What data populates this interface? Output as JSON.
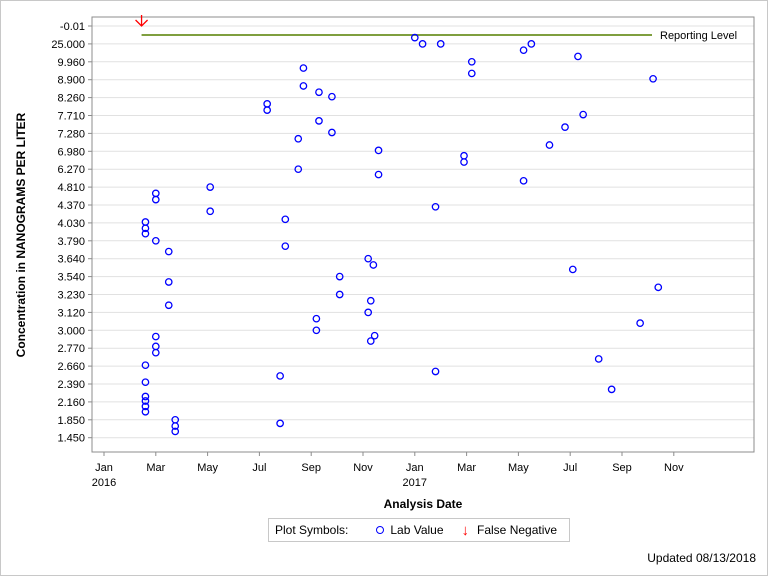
{
  "chart_data": {
    "type": "scatter",
    "xlabel": "Analysis Date",
    "ylabel": "Concentration in NANOGRAMS PER LITER",
    "x_ticks": [
      {
        "label": "Jan",
        "sub": "2016",
        "month": 0
      },
      {
        "label": "Mar",
        "sub": "",
        "month": 2
      },
      {
        "label": "May",
        "sub": "",
        "month": 4
      },
      {
        "label": "Jul",
        "sub": "",
        "month": 6
      },
      {
        "label": "Sep",
        "sub": "",
        "month": 8
      },
      {
        "label": "Nov",
        "sub": "",
        "month": 10
      },
      {
        "label": "Jan",
        "sub": "2017",
        "month": 12
      },
      {
        "label": "Mar",
        "sub": "",
        "month": 14
      },
      {
        "label": "May",
        "sub": "",
        "month": 16
      },
      {
        "label": "Jul",
        "sub": "",
        "month": 18
      },
      {
        "label": "Sep",
        "sub": "",
        "month": 20
      },
      {
        "label": "Nov",
        "sub": "",
        "month": 22
      }
    ],
    "x_range_months_from_jan2016": [
      -0.45,
      25.1
    ],
    "y_ticks": [
      "-0.01",
      "25.000",
      "9.960",
      "8.900",
      "8.260",
      "7.710",
      "7.280",
      "6.980",
      "6.270",
      "4.810",
      "4.370",
      "4.030",
      "3.790",
      "3.640",
      "3.540",
      "3.230",
      "3.120",
      "3.000",
      "2.770",
      "2.660",
      "2.390",
      "2.160",
      "1.850",
      "1.450"
    ],
    "y_axis_note": "discrete value axis; points plotted by rank position (0 = top tick)",
    "grid": true,
    "reference_line": {
      "label": "Reporting Level",
      "y_index": 0.5,
      "start_month": 1.45,
      "color": "#7f9f3f"
    },
    "series": [
      {
        "name": "Lab Value",
        "color": "#0000ff",
        "marker": "circle",
        "points": [
          {
            "month": 1.6,
            "y_index": 10.95
          },
          {
            "month": 1.6,
            "y_index": 11.3
          },
          {
            "month": 1.6,
            "y_index": 11.6
          },
          {
            "month": 2.0,
            "y_index": 9.35
          },
          {
            "month": 2.0,
            "y_index": 9.7
          },
          {
            "month": 2.0,
            "y_index": 12.0
          },
          {
            "month": 2.5,
            "y_index": 12.6
          },
          {
            "month": 2.5,
            "y_index": 14.3
          },
          {
            "month": 2.5,
            "y_index": 15.6
          },
          {
            "month": 4.1,
            "y_index": 9.0
          },
          {
            "month": 4.1,
            "y_index": 10.35
          },
          {
            "month": 2.0,
            "y_index": 17.35
          },
          {
            "month": 2.0,
            "y_index": 17.9
          },
          {
            "month": 2.0,
            "y_index": 18.25
          },
          {
            "month": 1.6,
            "y_index": 18.95
          },
          {
            "month": 1.6,
            "y_index": 19.9
          },
          {
            "month": 1.6,
            "y_index": 20.7
          },
          {
            "month": 1.6,
            "y_index": 20.95
          },
          {
            "month": 1.6,
            "y_index": 21.25
          },
          {
            "month": 1.6,
            "y_index": 21.55
          },
          {
            "month": 2.75,
            "y_index": 22.0
          },
          {
            "month": 2.75,
            "y_index": 22.35
          },
          {
            "month": 2.75,
            "y_index": 22.65
          },
          {
            "month": 6.3,
            "y_index": 4.35
          },
          {
            "month": 6.3,
            "y_index": 4.7
          },
          {
            "month": 7.7,
            "y_index": 2.35
          },
          {
            "month": 7.7,
            "y_index": 3.35
          },
          {
            "month": 8.3,
            "y_index": 3.7
          },
          {
            "month": 8.3,
            "y_index": 5.3
          },
          {
            "month": 8.8,
            "y_index": 3.95
          },
          {
            "month": 8.8,
            "y_index": 5.95
          },
          {
            "month": 7.5,
            "y_index": 6.3
          },
          {
            "month": 7.5,
            "y_index": 8.0
          },
          {
            "month": 7.0,
            "y_index": 10.8
          },
          {
            "month": 7.0,
            "y_index": 12.3
          },
          {
            "month": 10.6,
            "y_index": 6.95
          },
          {
            "month": 10.6,
            "y_index": 8.3
          },
          {
            "month": 8.2,
            "y_index": 16.35
          },
          {
            "month": 8.2,
            "y_index": 17.0
          },
          {
            "month": 9.1,
            "y_index": 14.0
          },
          {
            "month": 9.1,
            "y_index": 15.0
          },
          {
            "month": 10.2,
            "y_index": 13.0
          },
          {
            "month": 10.4,
            "y_index": 13.35
          },
          {
            "month": 10.3,
            "y_index": 15.35
          },
          {
            "month": 10.2,
            "y_index": 16.0
          },
          {
            "month": 10.45,
            "y_index": 17.3
          },
          {
            "month": 10.3,
            "y_index": 17.6
          },
          {
            "month": 6.8,
            "y_index": 19.55
          },
          {
            "month": 6.8,
            "y_index": 22.2
          },
          {
            "month": 12.0,
            "y_index": 0.65
          },
          {
            "month": 12.3,
            "y_index": 1.0
          },
          {
            "month": 13.0,
            "y_index": 1.0
          },
          {
            "month": 14.2,
            "y_index": 2.0
          },
          {
            "month": 14.2,
            "y_index": 2.65
          },
          {
            "month": 13.9,
            "y_index": 7.25
          },
          {
            "month": 13.9,
            "y_index": 7.6
          },
          {
            "month": 12.8,
            "y_index": 10.1
          },
          {
            "month": 12.8,
            "y_index": 19.3
          },
          {
            "month": 16.2,
            "y_index": 1.35
          },
          {
            "month": 16.5,
            "y_index": 1.0
          },
          {
            "month": 18.3,
            "y_index": 1.7
          },
          {
            "month": 16.2,
            "y_index": 8.65
          },
          {
            "month": 17.2,
            "y_index": 6.65
          },
          {
            "month": 17.8,
            "y_index": 5.65
          },
          {
            "month": 18.5,
            "y_index": 4.95
          },
          {
            "month": 18.1,
            "y_index": 13.6
          },
          {
            "month": 21.2,
            "y_index": 2.95
          },
          {
            "month": 21.4,
            "y_index": 14.6
          },
          {
            "month": 20.7,
            "y_index": 16.6
          },
          {
            "month": 19.1,
            "y_index": 18.6
          },
          {
            "month": 19.6,
            "y_index": 20.3
          }
        ]
      },
      {
        "name": "False Negative",
        "color": "#ff0000",
        "marker": "down-arrow",
        "points": [
          {
            "month": 1.45,
            "y_index": 0.0
          }
        ]
      }
    ]
  },
  "legend": {
    "title": "Plot Symbols:",
    "items": [
      {
        "label": "Lab Value",
        "icon": "circle-icon"
      },
      {
        "label": "False Negative",
        "icon": "down-arrow-icon"
      }
    ]
  },
  "footer": {
    "updated": "Updated 08/13/2018"
  }
}
